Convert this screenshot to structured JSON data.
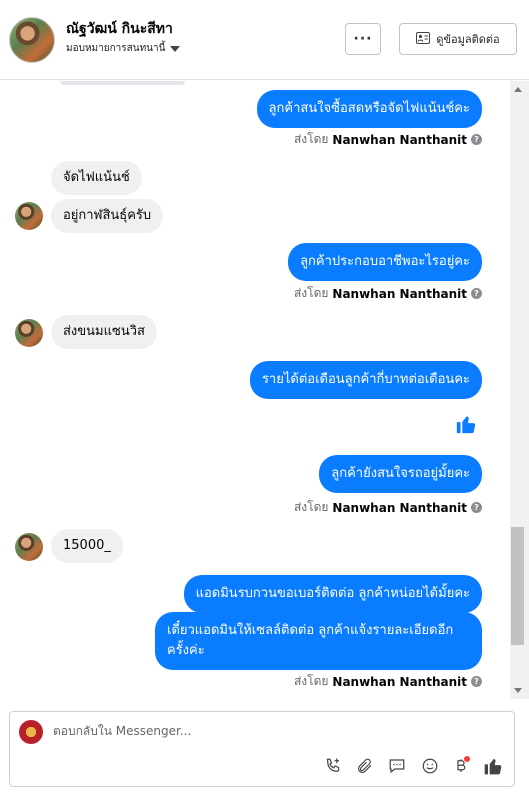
{
  "header": {
    "name": "ณัฐวัฒน์ กินะสีทา",
    "assign_label": "มอบหมายการสนทนานี้",
    "more_label": "···",
    "contact_label": "ดูข้อมูลติดต่อ"
  },
  "messages": [
    {
      "id": "m1",
      "text": "ลูกค้าสนใจซื้อสดหรือจัดไฟแน้นช์คะ",
      "sent_prefix": "ส่งโดย",
      "sent_name": "Nanwhan Nanthanit"
    },
    {
      "id": "m2",
      "text": "จัดไฟแน้นช์"
    },
    {
      "id": "m3",
      "text": "อยู่กาฬสินธุ์ครับ"
    },
    {
      "id": "m4",
      "text": "ลูกค้าประกอบอาชีพอะไรอยู่คะ",
      "sent_prefix": "ส่งโดย",
      "sent_name": "Nanwhan Nanthanit"
    },
    {
      "id": "m5",
      "text": "ส่งขนมแซนวิส"
    },
    {
      "id": "m6",
      "text": "รายได้ต่อเดือนลูกค้ากี่บาทต่อเดือนคะ"
    },
    {
      "id": "m7",
      "text": "ลูกค้ายังสนใจรถอยู่มั้ยคะ",
      "sent_prefix": "ส่งโดย",
      "sent_name": "Nanwhan Nanthanit"
    },
    {
      "id": "m8",
      "text": "15000_"
    },
    {
      "id": "m9",
      "text": "แอดมินรบกวนขอเบอร์ติดต่อ ลูกค้าหน่อยได้มั้ยคะ"
    },
    {
      "id": "m10",
      "line1": "เดี๋ยวแอดมินให้เซลล์ติดต่อ ลูกค้าแจ้งรายละเอียดอีก",
      "line2": "ครั้งค่ะ",
      "sent_prefix": "ส่งโดย",
      "sent_name": "Nanwhan Nanthanit"
    }
  ],
  "composer": {
    "placeholder": "ตอบกลับใน Messenger..."
  },
  "icons": {
    "call": "phone-plus-icon",
    "attach": "paperclip-icon",
    "saved_reply": "chat-bubble-icon",
    "emoji": "smiley-icon",
    "payment": "baht-icon",
    "like": "thumbs-up-icon"
  },
  "colors": {
    "outgoing_bubble": "#0a7cff",
    "incoming_bubble": "#f0f0f0",
    "like_icon": "#0a7cff"
  }
}
